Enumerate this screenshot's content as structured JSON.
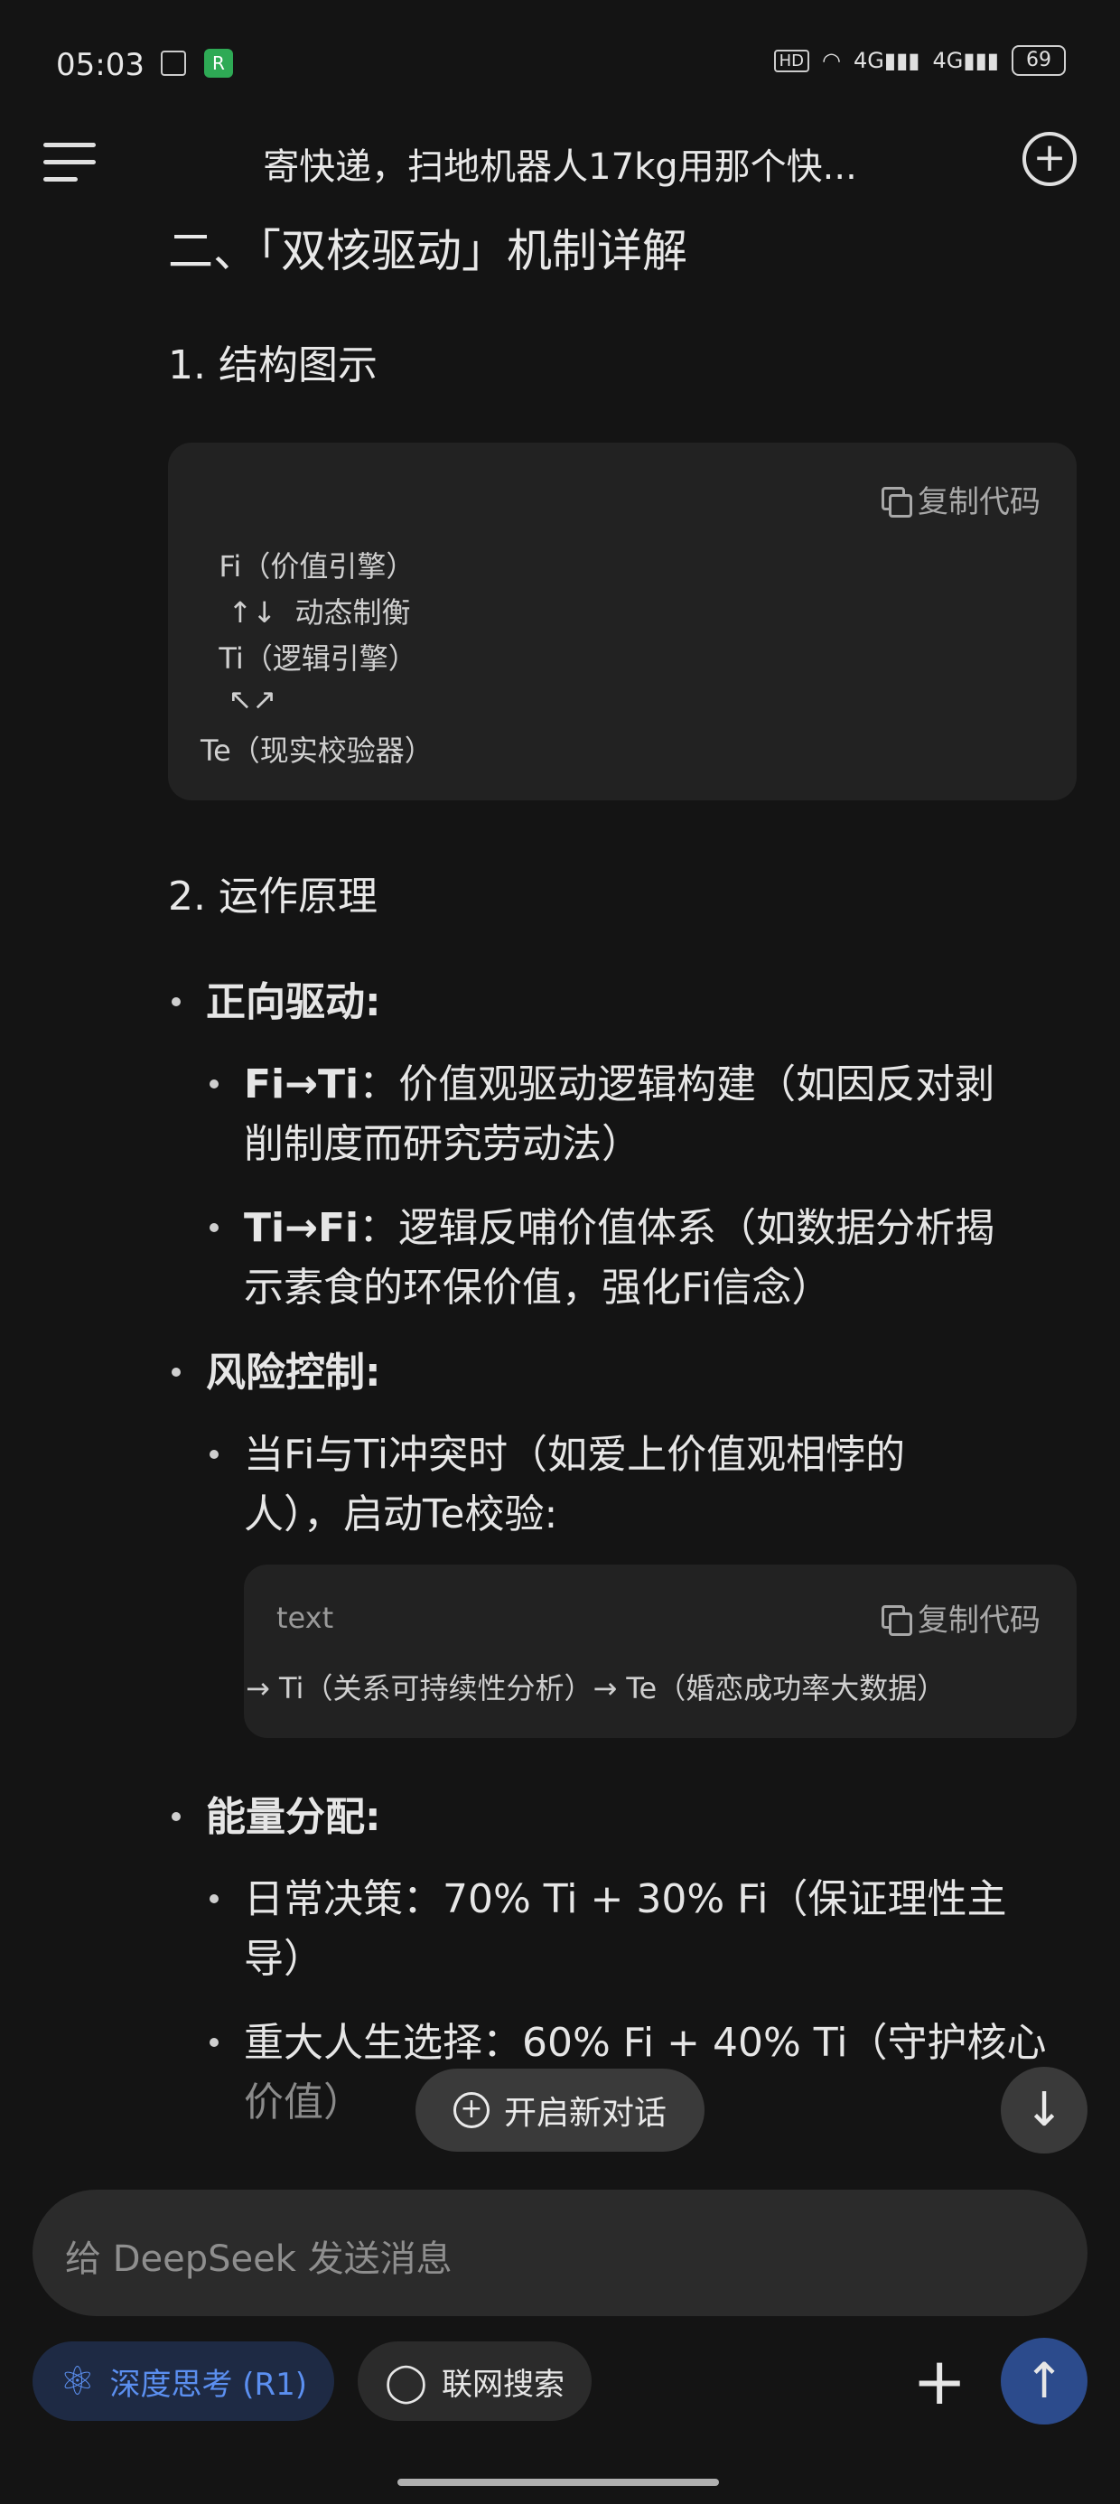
{
  "status": {
    "time": "05:03",
    "battery": "69"
  },
  "header": {
    "title": "寄快递，扫地机器人17kg用那个快..."
  },
  "content": {
    "h2": "二、「双核驱动」机制详解",
    "sec1_title": "1. 结构图示",
    "code1": {
      "copy_label": "复制代码",
      "lines": [
        "  Fi（价值引擎）",
        "   ↑↓  动态制衡",
        "  Ti（逻辑引擎）",
        "   ↖↗",
        "Te（现实校验器）"
      ]
    },
    "sec2_title": "2. 运作原理",
    "bullets": {
      "forward": "正向驱动:",
      "fi_ti_label": "Fi→Ti",
      "fi_ti_text_1": "：价值观驱动逻辑构建（如因反对剥",
      "fi_ti_text_2": "削制度而研究劳动法）",
      "ti_fi_label": "Ti→Fi",
      "ti_fi_text_1": "：逻辑反哺价值体系（如数据分析揭",
      "ti_fi_text_2": "示素食的环保价值，强化Fi信念）",
      "risk": "风险控制:",
      "risk_1": "当Fi与Ti冲突时（如爱上价值观相悖的",
      "risk_2": "人），启动Te校验:",
      "energy": "能量分配:",
      "daily_1": "日常决策：70% Ti + 30% Fi（保证理性主",
      "daily_2": "导）",
      "major_1": "重大人生选择：60% Fi + 40% Ti（守护核心",
      "major_2": "价值）"
    },
    "code2": {
      "lang": "text",
      "copy_label": "复制代码",
      "line": "→ Ti（关系可持续性分析）→ Te（婚恋成功率大数据）"
    }
  },
  "actions": {
    "new_chat": "开启新对话",
    "input_placeholder": "给 DeepSeek 发送消息",
    "deep_think": "深度思考 (R1)",
    "web_search": "联网搜索"
  }
}
